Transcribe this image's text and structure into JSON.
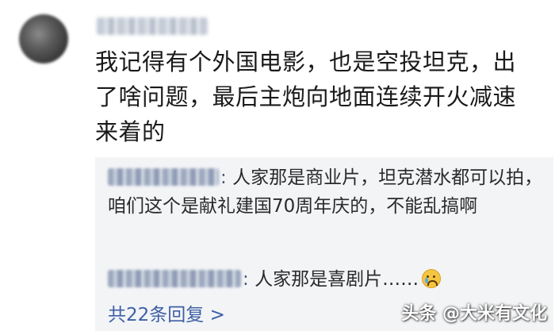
{
  "comment": {
    "text": "我记得有个外国电影，也是空投坦克，出了啥问题，最后主炮向地面连续开火减速来着的"
  },
  "replies": [
    {
      "separator": ": ",
      "text": "人家那是商业片，坦克潜水都可以拍，咱们这个是献礼建国70周年庆的，不能乱搞啊"
    },
    {
      "separator": ": ",
      "text": "人家那是喜剧片……"
    }
  ],
  "reply_link": {
    "label": "共22条回复 >"
  },
  "watermark": {
    "text": "头条 @大米有文化"
  },
  "icons": {
    "avatar": "blurred-avatar",
    "reply2_emoji": "crying-laughing-emoji"
  }
}
